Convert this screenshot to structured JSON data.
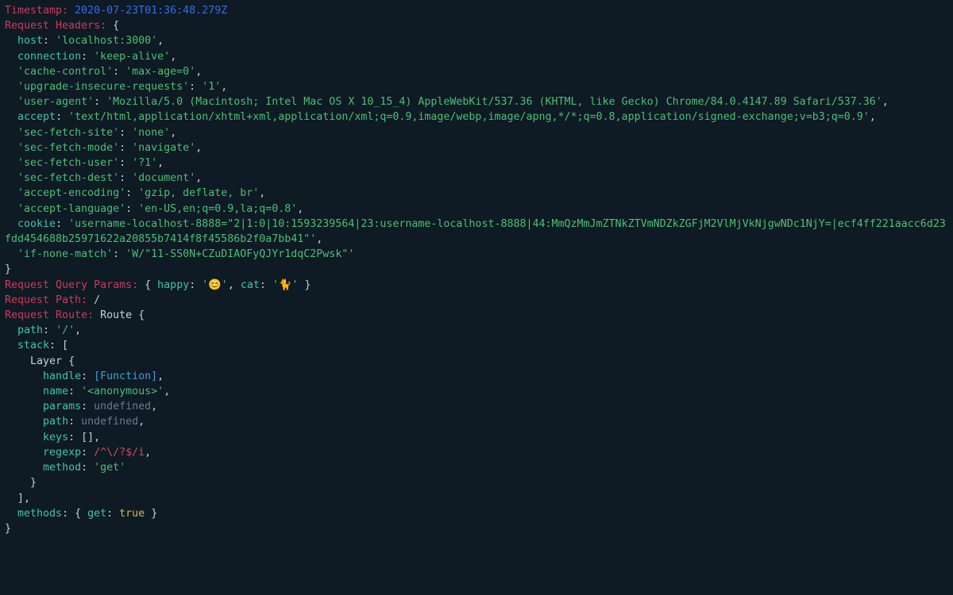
{
  "timestamp_label": "Timestamp:",
  "timestamp_value": "2020-07-23T01:36:48.279Z",
  "headers_label": "Request Headers:",
  "headers": {
    "host": "localhost:3000",
    "connection": "keep-alive",
    "cache-control": "max-age=0",
    "upgrade-insecure-requests": "1",
    "user-agent": "Mozilla/5.0 (Macintosh; Intel Mac OS X 10_15_4) AppleWebKit/537.36 (KHTML, like Gecko) Chrome/84.0.4147.89 Safari/537.36",
    "accept": "text/html,application/xhtml+xml,application/xml;q=0.9,image/webp,image/apng,*/*;q=0.8,application/signed-exchange;v=b3;q=0.9",
    "sec-fetch-site": "none",
    "sec-fetch-mode": "navigate",
    "sec-fetch-user": "?1",
    "sec-fetch-dest": "document",
    "accept-encoding": "gzip, deflate, br",
    "accept-language": "en-US,en;q=0.9,la;q=0.8",
    "cookie": "username-localhost-8888=\"2|1:0|10:1593239564|23:username-localhost-8888|44:MmQzMmJmZTNkZTVmNDZkZGFjM2VlMjVkNjgwNDc1NjY=|ecf4ff221aacc6d23fdd454688b25971622a20855b7414f8f45586b2f0a7bb41\"",
    "if-none-match": "W/\"11-SS0N+CZuDIAOFyQJYr1dqC2Pwsk\""
  },
  "query_label": "Request Query Params:",
  "query": {
    "happy": "😊",
    "cat": "🐈"
  },
  "path_label": "Request Path:",
  "path_value": "/",
  "route_label": "Request Route:",
  "route_name": "Route",
  "route": {
    "path": "/",
    "stack_label": "stack",
    "layer_name": "Layer",
    "layer": {
      "handle_label": "handle",
      "handle_value": "[Function]",
      "name_label": "name",
      "name_value": "<anonymous>",
      "params_label": "params",
      "params_value": "undefined",
      "path_label": "path",
      "path_value": "undefined",
      "keys_label": "keys",
      "keys_value": "[]",
      "regexp_label": "regexp",
      "regexp_value": "/^\\/?$/i",
      "method_label": "method",
      "method_value": "get"
    },
    "methods_label": "methods",
    "methods_key": "get",
    "methods_value": "true"
  }
}
